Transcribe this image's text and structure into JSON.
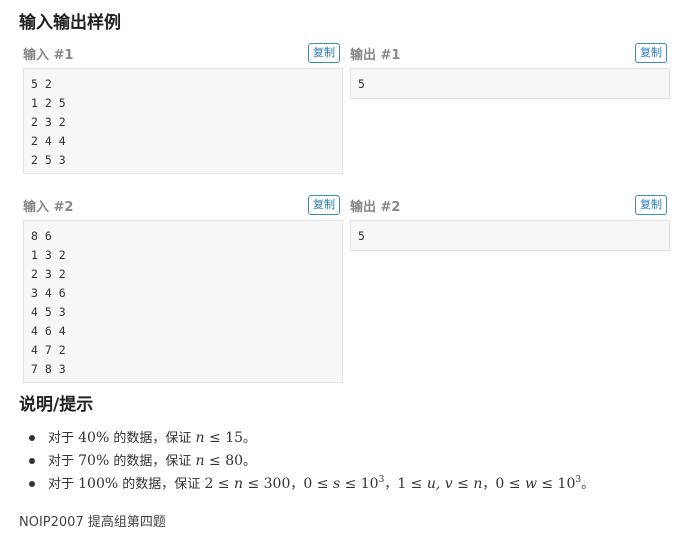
{
  "section_io": {
    "title": "输入输出样例"
  },
  "examples": [
    {
      "input_label": "输入 #1",
      "output_label": "输出 #1",
      "copy_label": "复制",
      "input_lines": [
        "5 2",
        "1 2 5",
        "2 3 2",
        "2 4 4",
        "2 5 3"
      ],
      "output_lines": [
        "5"
      ]
    },
    {
      "input_label": "输入 #2",
      "output_label": "输出 #2",
      "copy_label": "复制",
      "input_lines": [
        "8 6",
        "1 3 2",
        "2 3 2",
        "3 4 6",
        "4 5 3",
        "4 6 4",
        "4 7 2",
        "7 8 3"
      ],
      "output_lines": [
        "5"
      ]
    }
  ],
  "section_hint": {
    "title": "说明/提示"
  },
  "hints": [
    {
      "pre": "对于 ",
      "pct": "40%",
      "mid": " 的数据，保证 ",
      "var": "n",
      "rel": " ≤ ",
      "val": "15",
      "end": "。"
    },
    {
      "pre": "对于 ",
      "pct": "70%",
      "mid": " 的数据，保证 ",
      "var": "n",
      "rel": " ≤ ",
      "val": "80",
      "end": "。"
    },
    {
      "pre": "对于 ",
      "pct": "100%",
      "mid": " 的数据，保证 ",
      "c1": "2 ≤ ",
      "c1v": "n",
      "c1b": " ≤ 300",
      "sep1": "，",
      "c2": "0 ≤ ",
      "c2v": "s",
      "c2b": " ≤ 10",
      "c2e": "3",
      "sep2": "，",
      "c3": "1 ≤ ",
      "c3v": "u, v",
      "c3m": " ≤ ",
      "c3w": "n",
      "sep3": "，",
      "c4": "0 ≤ ",
      "c4v": "w",
      "c4b": " ≤ 10",
      "c4e": "3",
      "end": "。"
    }
  ],
  "source_text": "NOIP2007 提高组第四题"
}
